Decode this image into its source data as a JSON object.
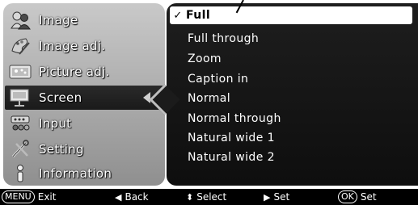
{
  "left_menu": {
    "items": [
      {
        "label": "Image",
        "icon": "people-icon"
      },
      {
        "label": "Image adj.",
        "icon": "palette-icon"
      },
      {
        "label": "Picture adj.",
        "icon": "picture-icon"
      },
      {
        "label": "Screen",
        "icon": "screen-icon"
      },
      {
        "label": "Input",
        "icon": "input-icon"
      },
      {
        "label": "Setting",
        "icon": "tools-icon"
      },
      {
        "label": "Information",
        "icon": "info-icon"
      }
    ]
  },
  "screen_menu": {
    "options": [
      "Full",
      "Full through",
      "Zoom",
      "Caption in",
      "Normal",
      "Normal through",
      "Natural wide 1",
      "Natural wide 2"
    ],
    "selected": "Full",
    "check_mark": "✓"
  },
  "help_bar": {
    "exit_key": "MENU",
    "exit_label": "Exit",
    "back_label": "Back",
    "select_label": "Select",
    "set_label": "Set",
    "ok_key": "OK",
    "ok_set_label": "Set"
  },
  "colors": {
    "left_panel": "#b0b0b0",
    "right_panel": "#141414",
    "selection_bg": "#ffffff",
    "help_bar_bg": "#000000"
  }
}
